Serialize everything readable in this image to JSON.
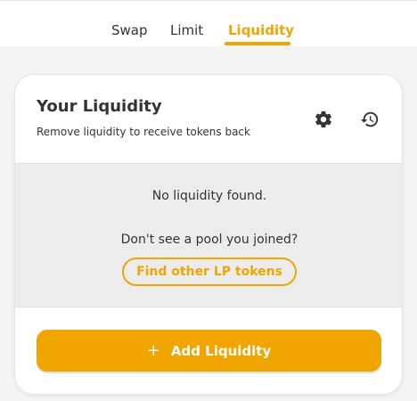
{
  "tabs": {
    "swap": "Swap",
    "limit": "Limit",
    "liquidity": "Liquidity",
    "active": "Liquidity"
  },
  "colors": {
    "accent": "#f0a500",
    "text": "#333333",
    "panel_bg": "#ececec",
    "page_bg": "#f4f4f4"
  },
  "card": {
    "title": "Your Liquidity",
    "subtitle": "Remove liquidity to receive tokens back",
    "icons": {
      "settings": "gear-icon",
      "history": "history-icon"
    }
  },
  "empty_state": {
    "message": "No liquidity found.",
    "hint": "Don't see a pool you joined?",
    "find_button": "Find other LP tokens"
  },
  "footer": {
    "add_button": "Add Liquidity",
    "add_icon": "plus-icon"
  }
}
